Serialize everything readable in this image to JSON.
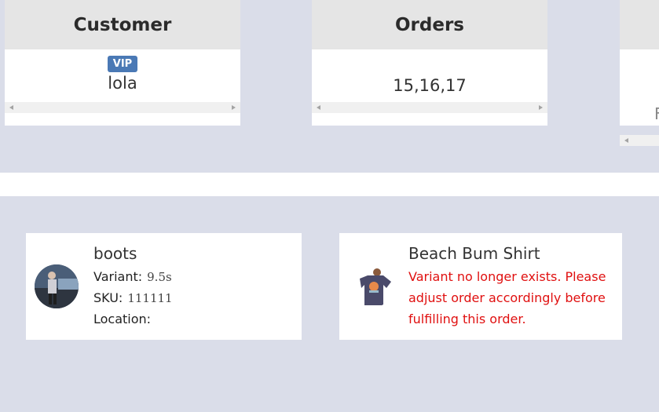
{
  "columns": {
    "customer": {
      "header": "Customer",
      "badge": "VIP",
      "value": "lola"
    },
    "orders": {
      "header": "Orders",
      "value": "15,16,17"
    },
    "third": {
      "header": "",
      "partial_text": "F"
    }
  },
  "line_items": [
    {
      "name": "boots",
      "variant_label": "Variant:",
      "variant_value": "9.5s",
      "sku_label": "SKU:",
      "sku_value": "111111",
      "location_label": "Location:",
      "location_value": ""
    },
    {
      "name": "Beach Bum Shirt",
      "warning": "Variant no longer exists. Please adjust order accordingly before fulfilling this order."
    }
  ],
  "colors": {
    "badge": "#4a79b5",
    "warning": "#e01010",
    "background": "#dadde9"
  }
}
